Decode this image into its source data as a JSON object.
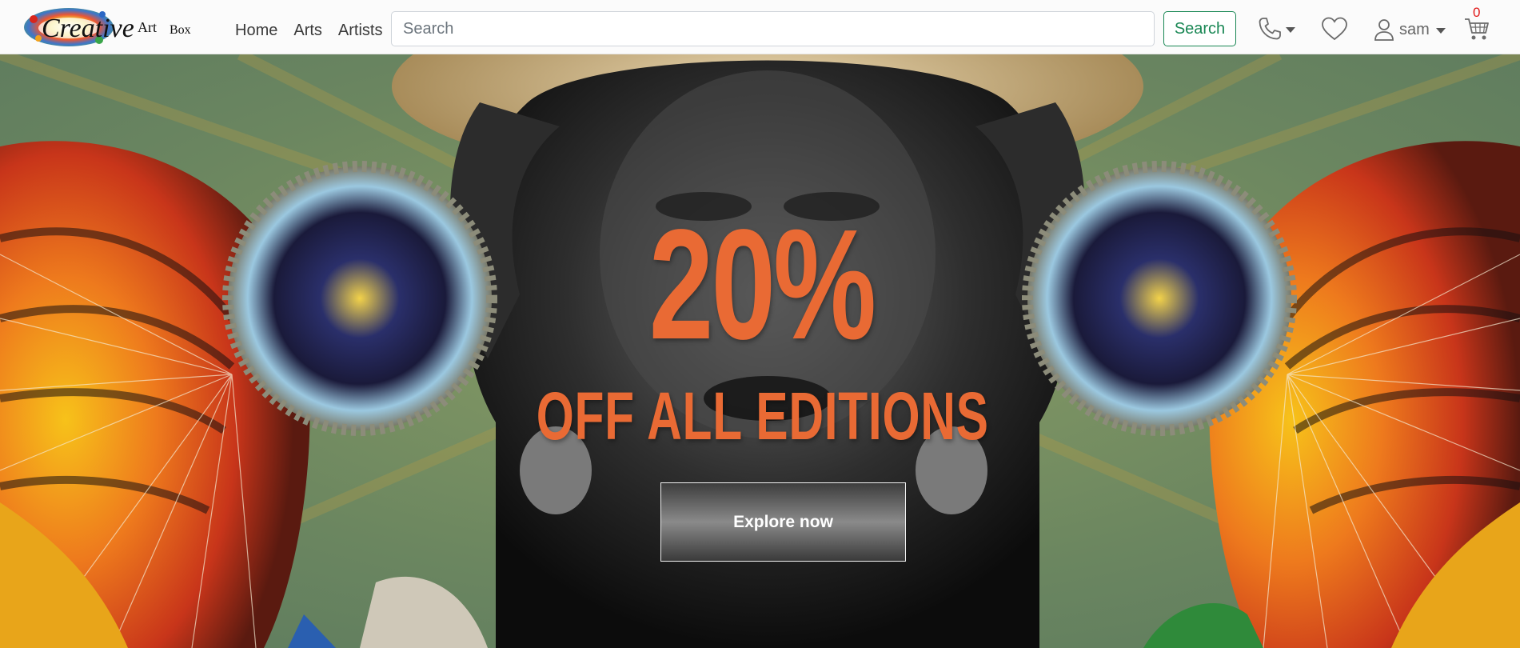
{
  "brand": {
    "logo_text_main": "Creative",
    "logo_text_art": "Art",
    "logo_text_box": "Box"
  },
  "nav": {
    "links": [
      "Home",
      "Arts",
      "Artists"
    ]
  },
  "search": {
    "placeholder": "Search",
    "value": "",
    "button_label": "Search"
  },
  "user": {
    "name": "sam"
  },
  "cart": {
    "count": "0"
  },
  "icons": {
    "phone": "phone-icon",
    "wishlist": "heart-icon",
    "user": "user-icon",
    "cart": "cart-icon"
  },
  "hero": {
    "headline": "20%",
    "subheadline": "OFF ALL EDITIONS",
    "cta_label": "Explore now"
  },
  "colors": {
    "accent_orange": "#e96a34",
    "success_green": "#198754",
    "badge_red": "#e01818"
  }
}
